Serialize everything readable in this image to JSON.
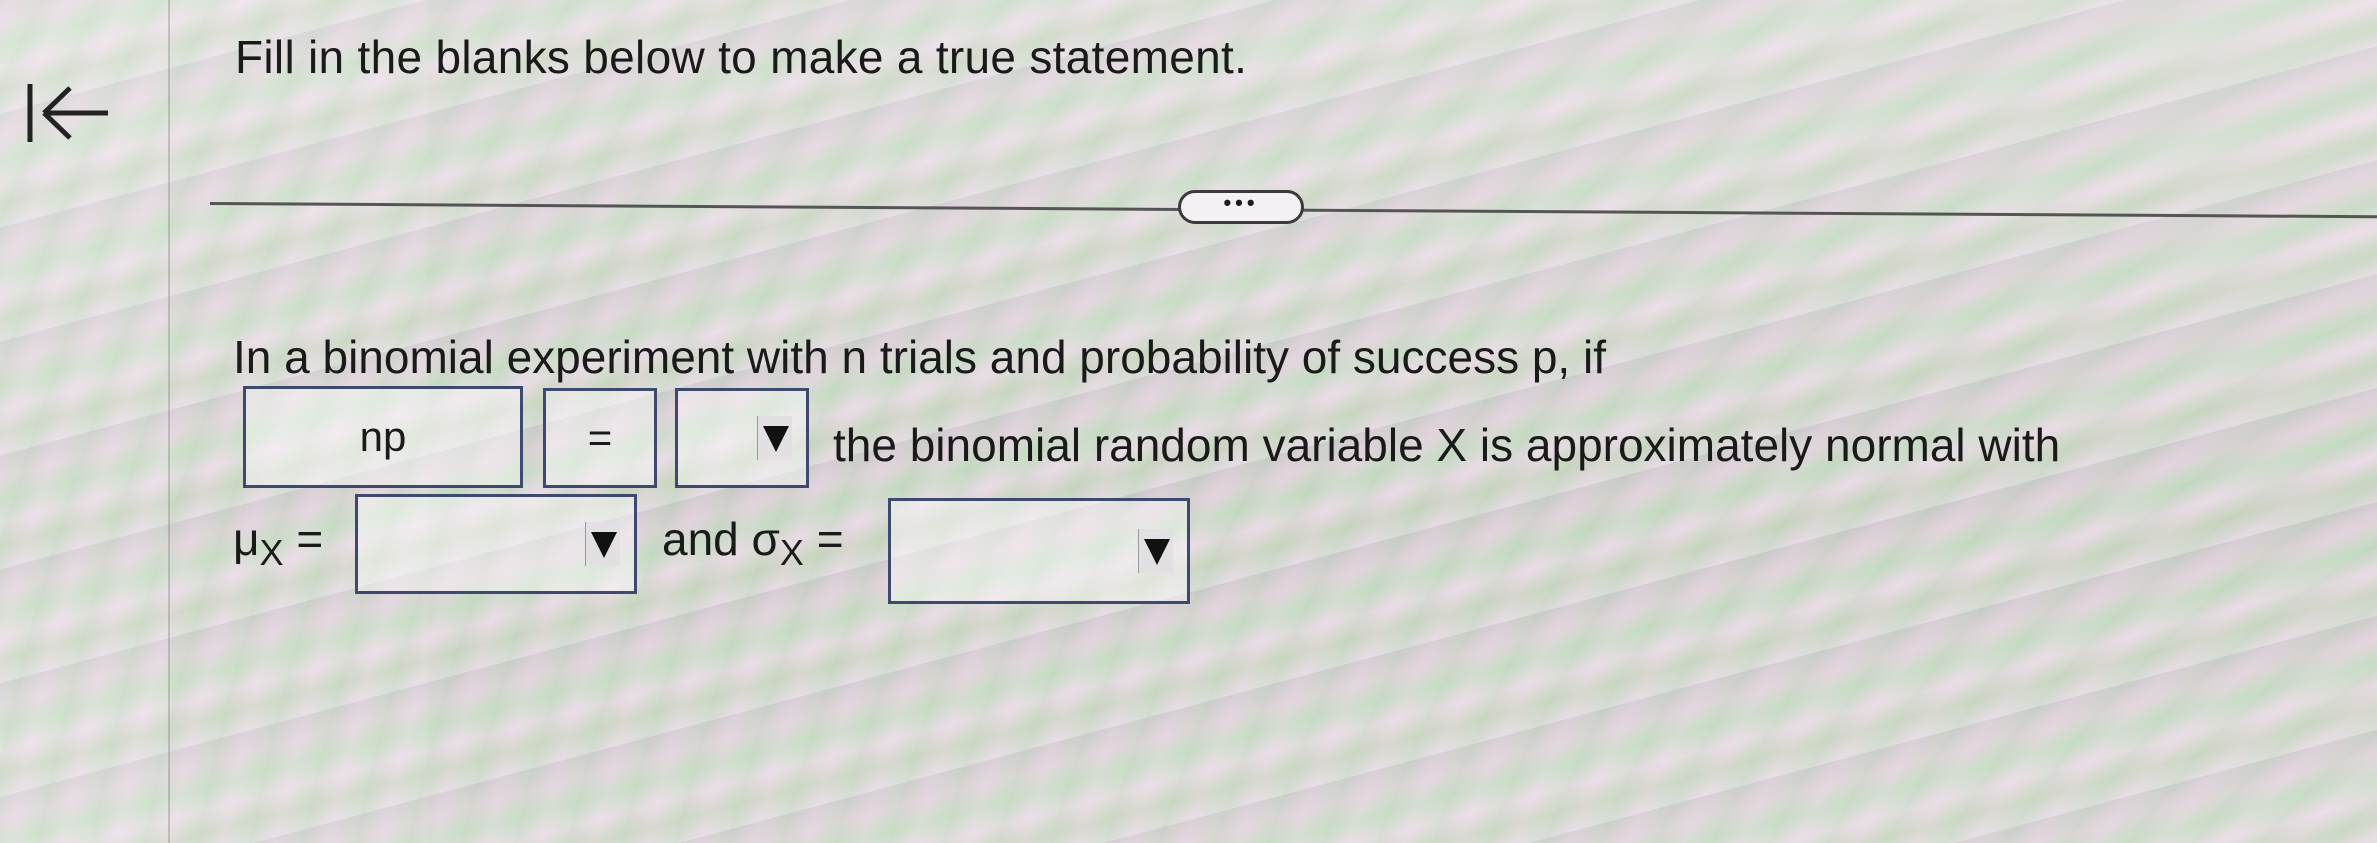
{
  "header": {
    "title": "Fill in the blanks below to make a true statement.",
    "more_label": "•••"
  },
  "icons": {
    "back": "back-to-start-icon",
    "dropdown": "dropdown-triangle-icon"
  },
  "question": {
    "prompt": "In a binomial experiment with n trials and probability of success p, if",
    "blank1_value": "np",
    "blank2_value": "=",
    "blank3_value": "",
    "continuation": "the binomial random variable X is approximately normal with",
    "mu_symbol": "μ",
    "mu_sub": "X",
    "equals": "=",
    "and_text": "and",
    "sigma_symbol": "σ",
    "sigma_sub": "X",
    "equals2": "=",
    "mu_value": "",
    "sigma_value": ""
  }
}
